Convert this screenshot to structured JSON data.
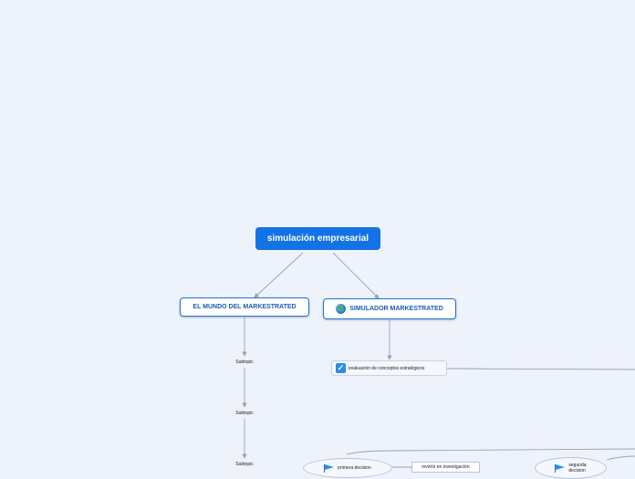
{
  "map": {
    "root": "simulación empresarial",
    "branch_left": "EL MUNDO DEL MARKESTRATED",
    "branch_right": "SIMULADOR MARKESTRATED",
    "evaluation": "evaluación de conceptos estratégicos",
    "subtopics": [
      "Subtopic",
      "Subtopic",
      "Subtopic"
    ],
    "first_decision": "primera decision",
    "invest_research": "invertir en investigación",
    "second_decision_line1": "segunda",
    "second_decision_line2": "decision"
  },
  "icons": {
    "branch_right": "globe-icon",
    "evaluation": "checkbox-checked-icon",
    "decisions": "flag-icon"
  },
  "colors": {
    "background": "#eef2fb",
    "root_fill": "#1373e6",
    "branch_border": "#1f73d6",
    "connector": "#9aa3b2"
  }
}
